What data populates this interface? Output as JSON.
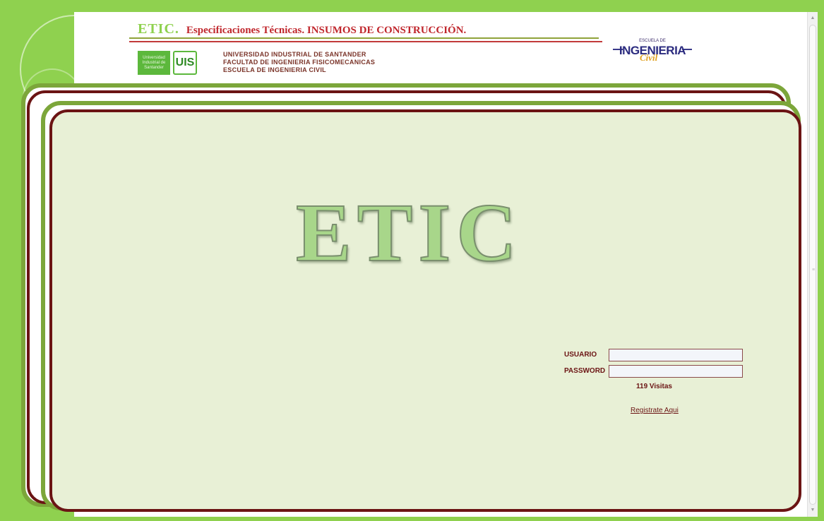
{
  "header": {
    "brand": "ETIC.",
    "title": "Especificaciones Técnicas. INSUMOS DE CONSTRUCCIÓN.",
    "uis_box_text": "Universidad Industrial de Santander",
    "uis_logo_text": "UIS",
    "university_lines": [
      "UNIVERSIDAD INDUSTRIAL DE SANTANDER",
      "FACULTAD DE INGENIERIA FISICOMECANICAS",
      "ESCUELA DE INGENIERIA CIVIL"
    ],
    "school_logo": {
      "small": "ESCUELA DE",
      "big": "INGENIERIA",
      "script": "Civil"
    }
  },
  "main": {
    "logo_text": "ETIC"
  },
  "login": {
    "usuario_label": "USUARIO",
    "password_label": "PASSWORD",
    "usuario_value": "",
    "password_value": "",
    "visits": "119 Visitas",
    "register_link": "Registrate Aqui"
  },
  "colors": {
    "background_green": "#8fd14f",
    "frame_green": "#7ca63a",
    "frame_maroon": "#6b1414",
    "panel_fill": "#e8f0d6",
    "title_red": "#c0262c"
  },
  "icons": {
    "scroll_up": "triangle-up",
    "scroll_down": "triangle-down"
  }
}
